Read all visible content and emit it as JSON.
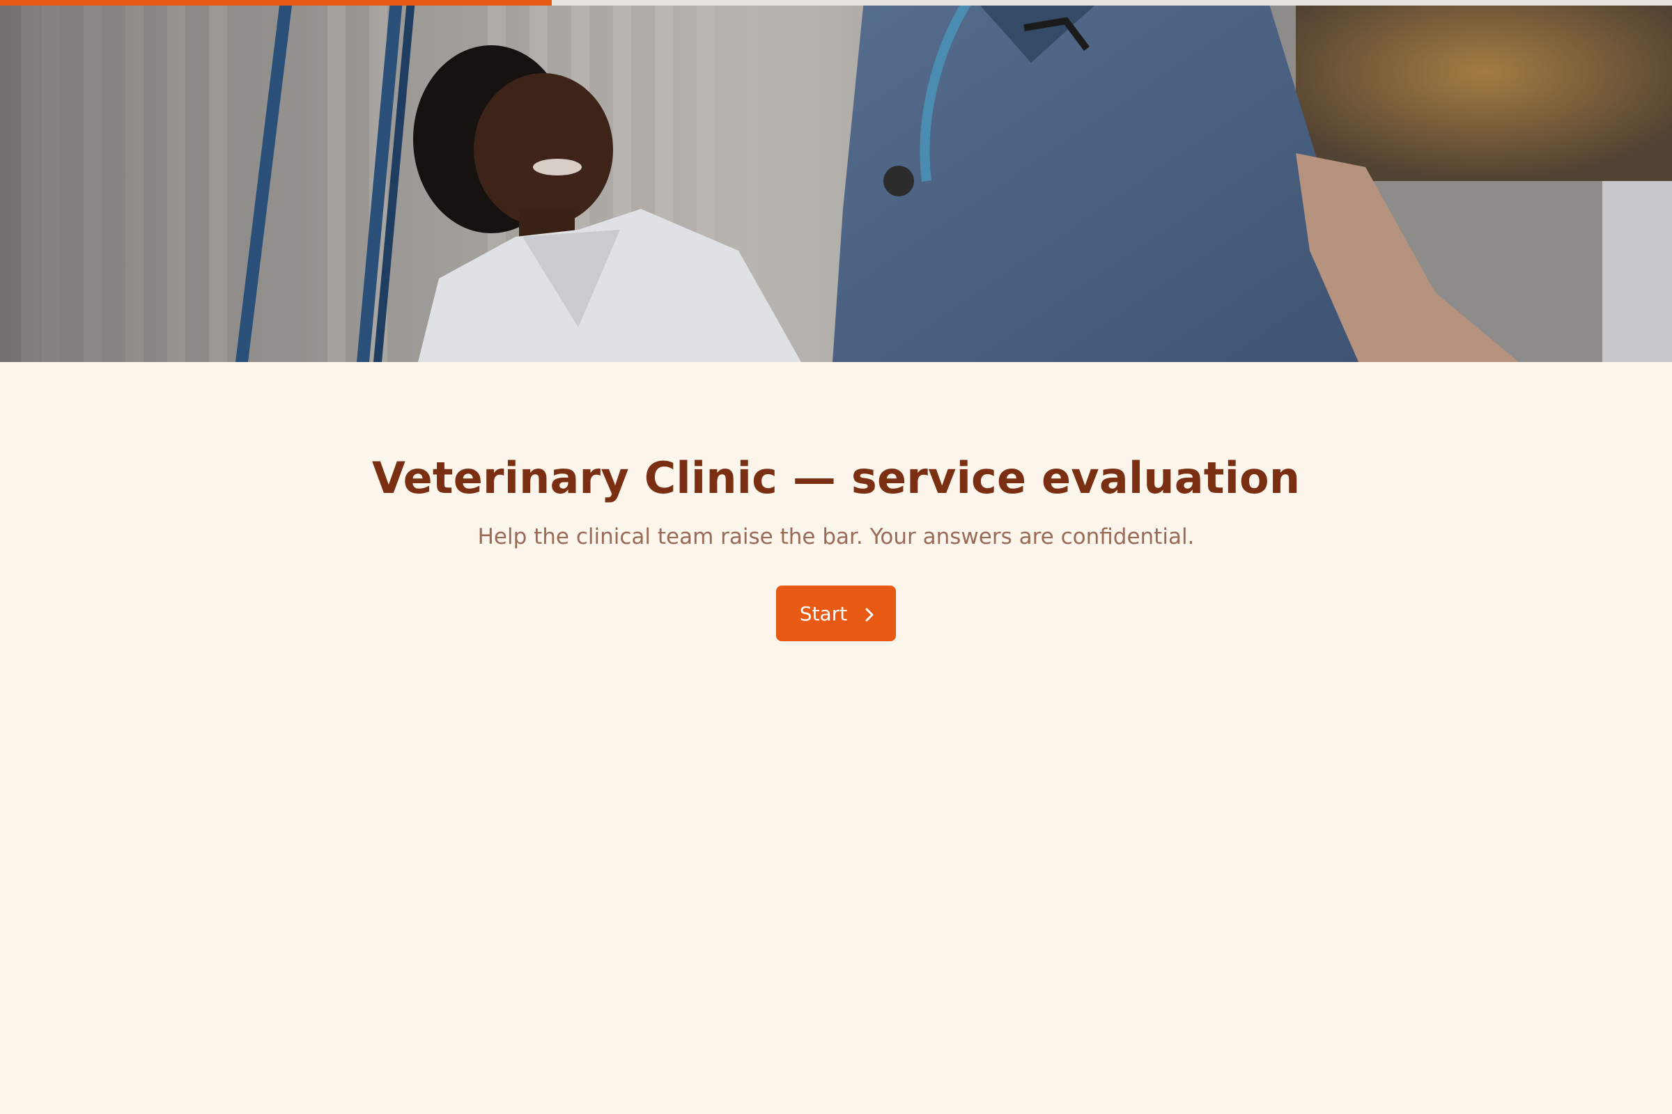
{
  "progress": {
    "fraction": 0.33
  },
  "hero": {
    "image": "clinic-staff-photo"
  },
  "survey": {
    "title": "Veterinary Clinic — service evaluation",
    "subtitle": "Help the clinical team raise the bar. Your answers are confidential.",
    "start_label": "Start",
    "start_icon": "chevron-right-icon"
  },
  "colors": {
    "accent": "#e85a14",
    "title": "#7a2e12",
    "subtitle": "#9a6a58",
    "background": "#fdf6ec"
  }
}
